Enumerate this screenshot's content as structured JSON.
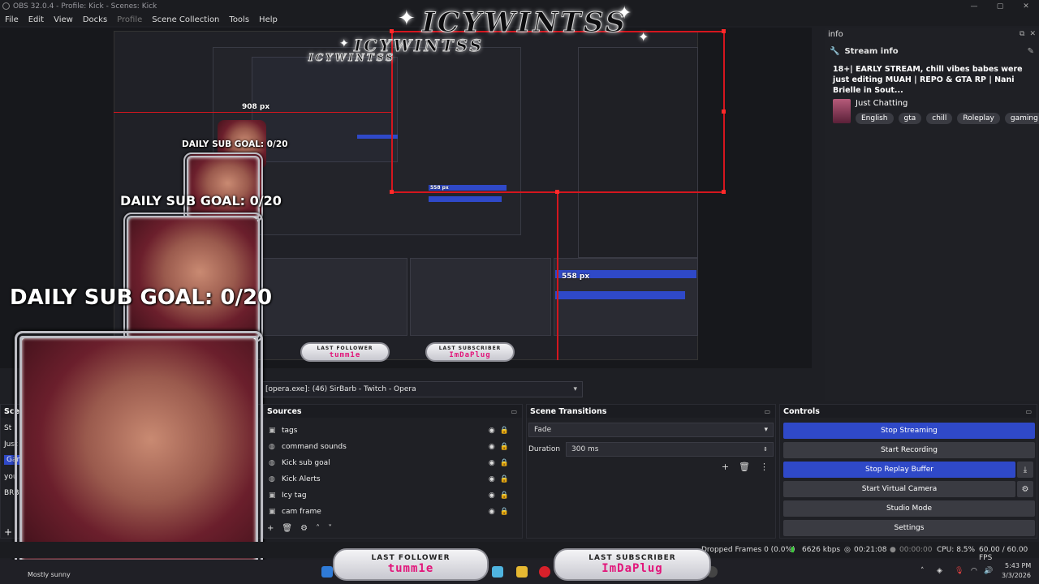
{
  "window": {
    "title": "OBS 32.0.4 - Profile: Kick - Scenes: Kick",
    "minimize": "—",
    "maximize": "▢",
    "close": "✕"
  },
  "menu": {
    "file": "File",
    "edit": "Edit",
    "view": "View",
    "docks": "Docks",
    "profile": "Profile",
    "scene_collection": "Scene Collection",
    "tools": "Tools",
    "help": "Help"
  },
  "overlay": {
    "streamer_name": "ICYWINTSS",
    "goal_large": "DAILY SUB GOAL: 0/20",
    "goal_medium": "DAILY SUB GOAL: 0/20",
    "goal_small": "DAILY SUB GOAL: 0/20",
    "px_label_1": "908 px",
    "px_label_2": "558 px",
    "px_label_3": "558 px",
    "last_follower_label": "LAST FOLLOWER",
    "last_follower_name": "tumm1e",
    "last_subscriber_label": "LAST SUBSCRIBER",
    "last_subscriber_name": "ImDaPlug"
  },
  "info_dock": {
    "dock_title": "info",
    "section_title": "Stream info",
    "description": "18+| EARLY STREAM, chill vibes babes were just editing MUAH | REPO & GTA RP | Nani Brielle in Sout...",
    "category": "Just Chatting",
    "tags": [
      "English",
      "gta",
      "chill",
      "Roleplay",
      "gaming"
    ]
  },
  "source_selector": {
    "value": "[opera.exe]: (46) SirBarb - Twitch - Opera"
  },
  "scenes": {
    "title": "Scenes",
    "items": [
      "St",
      "Just",
      "Game",
      "you",
      "BRB"
    ]
  },
  "sources": {
    "title": "Sources",
    "items": [
      "tags",
      "command sounds",
      "Kick sub goal",
      "Kick Alerts",
      "Icy tag",
      "cam frame"
    ]
  },
  "transitions": {
    "title": "Scene Transitions",
    "transition": "Fade",
    "duration_label": "Duration",
    "duration_value": "300 ms"
  },
  "controls": {
    "title": "Controls",
    "stop_streaming": "Stop Streaming",
    "start_recording": "Start Recording",
    "stop_replay_buffer": "Stop Replay Buffer",
    "start_virtual_camera": "Start Virtual Camera",
    "studio_mode": "Studio Mode",
    "settings": "Settings"
  },
  "status": {
    "dropped_frames": "Dropped Frames 0 (0.0%)",
    "bitrate": "6626 kbps",
    "stream_time": "00:21:08",
    "rec_time": "00:00:00",
    "cpu": "CPU: 8.5%",
    "fps": "60.00 / 60.00 FPS"
  },
  "taskbar": {
    "weather": "Mostly sunny",
    "time": "5:43 PM",
    "date": "3/3/2026"
  },
  "colors": {
    "accent": "#2f49c8",
    "red_guide": "#d4161e",
    "panel": "#1f2025"
  }
}
